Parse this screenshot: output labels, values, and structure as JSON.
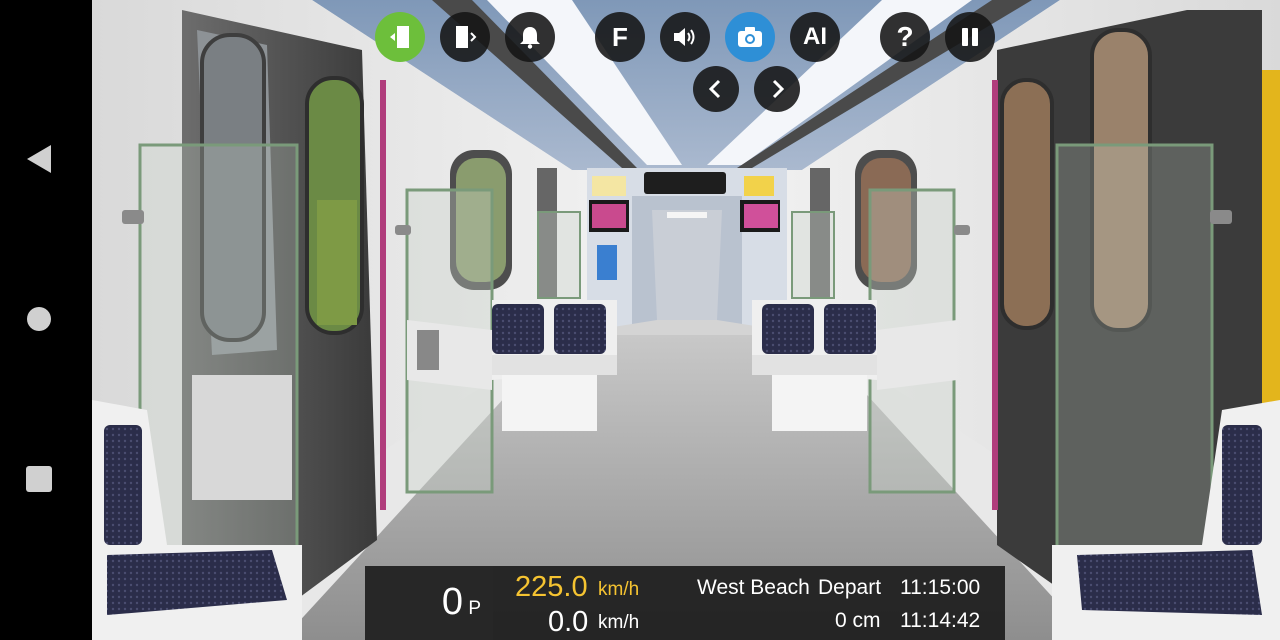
{
  "system_nav": {
    "back_icon": "back-triangle-icon",
    "home_icon": "home-circle-icon",
    "recents_icon": "recents-square-icon"
  },
  "hud": {
    "buttons": [
      {
        "name": "left-door-icon",
        "state": "active",
        "color": "#6dbf3b"
      },
      {
        "name": "right-door-icon",
        "state": "inactive"
      },
      {
        "name": "bell-icon",
        "state": "inactive"
      },
      {
        "name": "F",
        "label": "F",
        "state": "inactive"
      },
      {
        "name": "speaker-icon",
        "state": "inactive"
      },
      {
        "name": "camera-icon",
        "state": "active",
        "color": "#2e8fd6"
      },
      {
        "name": "AI",
        "label": "AI",
        "state": "inactive"
      },
      {
        "name": "help-icon",
        "label": "?",
        "state": "inactive"
      },
      {
        "name": "pause-icon",
        "state": "inactive"
      }
    ],
    "camera_prev_icon": "chevron-left-icon",
    "camera_next_icon": "chevron-right-icon"
  },
  "status": {
    "gear_value": "0",
    "gear_unit": "P",
    "target_speed": "225.0",
    "target_speed_unit": "km/h",
    "current_speed": "0.0",
    "current_speed_unit": "km/h",
    "station": "West Beach",
    "station_action": "Depart",
    "depart_time": "11:15:00",
    "distance": "0 cm",
    "current_time": "11:14:42"
  },
  "colors": {
    "target_speed": "#f5c331",
    "active_green": "#6dbf3b",
    "active_blue": "#2e8fd6",
    "hud_bg": "#141414"
  }
}
